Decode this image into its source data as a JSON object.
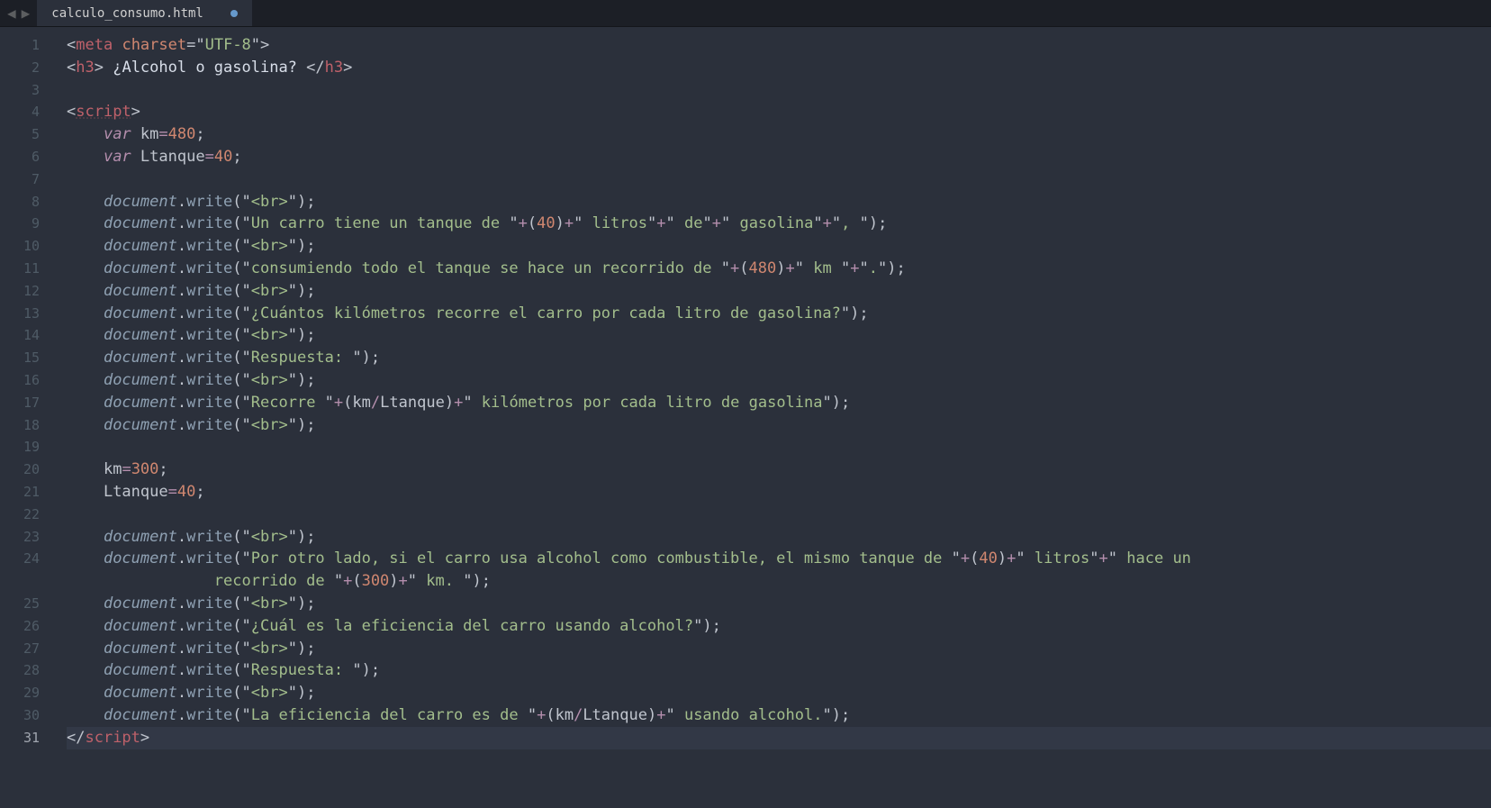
{
  "tab": {
    "filename": "calculo_consumo.html",
    "modified": true
  },
  "lineCount": 31,
  "activeLine": 31,
  "code": {
    "l1": [
      [
        "<",
        "c-punc"
      ],
      [
        "meta",
        "c-tag"
      ],
      [
        " ",
        "c-punc"
      ],
      [
        "charset",
        "c-attr"
      ],
      [
        "=",
        "c-op"
      ],
      [
        "\"",
        "c-punc"
      ],
      [
        "UTF-8",
        "c-string"
      ],
      [
        "\"",
        "c-punc"
      ],
      [
        ">",
        "c-punc"
      ]
    ],
    "l2": [
      [
        "<",
        "c-punc"
      ],
      [
        "h3",
        "c-tag"
      ],
      [
        ">",
        "c-punc"
      ],
      [
        " ¿Alcohol o gasolina? ",
        "c-text"
      ],
      [
        "</",
        "c-punc"
      ],
      [
        "h3",
        "c-tag"
      ],
      [
        ">",
        "c-punc"
      ]
    ],
    "l3": [],
    "l4": [
      [
        "<",
        "c-punc"
      ],
      [
        "script",
        "c-tag-dotted"
      ],
      [
        ">",
        "c-punc"
      ]
    ],
    "l5": [
      [
        "var",
        "c-store"
      ],
      [
        " ",
        "c-punc"
      ],
      [
        "km",
        "c-varname"
      ],
      [
        "=",
        "c-key"
      ],
      [
        "480",
        "c-num"
      ],
      [
        ";",
        "c-punc"
      ]
    ],
    "l6": [
      [
        "var",
        "c-store"
      ],
      [
        " ",
        "c-punc"
      ],
      [
        "Ltanque",
        "c-varname"
      ],
      [
        "=",
        "c-key"
      ],
      [
        "40",
        "c-num"
      ],
      [
        ";",
        "c-punc"
      ]
    ],
    "l7": [],
    "l8": [
      [
        "document",
        "c-obj"
      ],
      [
        ".",
        "c-punc"
      ],
      [
        "write",
        "c-func"
      ],
      [
        "(",
        "c-punc"
      ],
      [
        "\"",
        "c-punc"
      ],
      [
        "<br>",
        "c-string"
      ],
      [
        "\"",
        "c-punc"
      ],
      [
        ")",
        "c-punc"
      ],
      [
        ";",
        "c-punc"
      ]
    ],
    "l9": [
      [
        "document",
        "c-obj"
      ],
      [
        ".",
        "c-punc"
      ],
      [
        "write",
        "c-func"
      ],
      [
        "(",
        "c-punc"
      ],
      [
        "\"",
        "c-punc"
      ],
      [
        "Un carro tiene un tanque de ",
        "c-string"
      ],
      [
        "\"",
        "c-punc"
      ],
      [
        "+",
        "c-key"
      ],
      [
        "(",
        "c-punc"
      ],
      [
        "40",
        "c-num"
      ],
      [
        ")",
        "c-punc"
      ],
      [
        "+",
        "c-key"
      ],
      [
        "\"",
        "c-punc"
      ],
      [
        " litros",
        "c-string"
      ],
      [
        "\"",
        "c-punc"
      ],
      [
        "+",
        "c-key"
      ],
      [
        "\"",
        "c-punc"
      ],
      [
        " de",
        "c-string"
      ],
      [
        "\"",
        "c-punc"
      ],
      [
        "+",
        "c-key"
      ],
      [
        "\"",
        "c-punc"
      ],
      [
        " gasolina",
        "c-string"
      ],
      [
        "\"",
        "c-punc"
      ],
      [
        "+",
        "c-key"
      ],
      [
        "\"",
        "c-punc"
      ],
      [
        ", ",
        "c-string"
      ],
      [
        "\"",
        "c-punc"
      ],
      [
        ")",
        "c-punc"
      ],
      [
        ";",
        "c-punc"
      ]
    ],
    "l10": [
      [
        "document",
        "c-obj"
      ],
      [
        ".",
        "c-punc"
      ],
      [
        "write",
        "c-func"
      ],
      [
        "(",
        "c-punc"
      ],
      [
        "\"",
        "c-punc"
      ],
      [
        "<br>",
        "c-string"
      ],
      [
        "\"",
        "c-punc"
      ],
      [
        ")",
        "c-punc"
      ],
      [
        ";",
        "c-punc"
      ]
    ],
    "l11": [
      [
        "document",
        "c-obj"
      ],
      [
        ".",
        "c-punc"
      ],
      [
        "write",
        "c-func"
      ],
      [
        "(",
        "c-punc"
      ],
      [
        "\"",
        "c-punc"
      ],
      [
        "consumiendo todo el tanque se hace un recorrido de ",
        "c-string"
      ],
      [
        "\"",
        "c-punc"
      ],
      [
        "+",
        "c-key"
      ],
      [
        "(",
        "c-punc"
      ],
      [
        "480",
        "c-num"
      ],
      [
        ")",
        "c-punc"
      ],
      [
        "+",
        "c-key"
      ],
      [
        "\"",
        "c-punc"
      ],
      [
        " km ",
        "c-string"
      ],
      [
        "\"",
        "c-punc"
      ],
      [
        "+",
        "c-key"
      ],
      [
        "\"",
        "c-punc"
      ],
      [
        ".",
        "c-string"
      ],
      [
        "\"",
        "c-punc"
      ],
      [
        ")",
        "c-punc"
      ],
      [
        ";",
        "c-punc"
      ]
    ],
    "l12": [
      [
        "document",
        "c-obj"
      ],
      [
        ".",
        "c-punc"
      ],
      [
        "write",
        "c-func"
      ],
      [
        "(",
        "c-punc"
      ],
      [
        "\"",
        "c-punc"
      ],
      [
        "<br>",
        "c-string"
      ],
      [
        "\"",
        "c-punc"
      ],
      [
        ")",
        "c-punc"
      ],
      [
        ";",
        "c-punc"
      ]
    ],
    "l13": [
      [
        "document",
        "c-obj"
      ],
      [
        ".",
        "c-punc"
      ],
      [
        "write",
        "c-func"
      ],
      [
        "(",
        "c-punc"
      ],
      [
        "\"",
        "c-punc"
      ],
      [
        "¿Cuántos kilómetros recorre el carro por cada litro de gasolina?",
        "c-string"
      ],
      [
        "\"",
        "c-punc"
      ],
      [
        ")",
        "c-punc"
      ],
      [
        ";",
        "c-punc"
      ]
    ],
    "l14": [
      [
        "document",
        "c-obj"
      ],
      [
        ".",
        "c-punc"
      ],
      [
        "write",
        "c-func"
      ],
      [
        "(",
        "c-punc"
      ],
      [
        "\"",
        "c-punc"
      ],
      [
        "<br>",
        "c-string"
      ],
      [
        "\"",
        "c-punc"
      ],
      [
        ")",
        "c-punc"
      ],
      [
        ";",
        "c-punc"
      ]
    ],
    "l15": [
      [
        "document",
        "c-obj"
      ],
      [
        ".",
        "c-punc"
      ],
      [
        "write",
        "c-func"
      ],
      [
        "(",
        "c-punc"
      ],
      [
        "\"",
        "c-punc"
      ],
      [
        "Respuesta: ",
        "c-string"
      ],
      [
        "\"",
        "c-punc"
      ],
      [
        ")",
        "c-punc"
      ],
      [
        ";",
        "c-punc"
      ]
    ],
    "l16": [
      [
        "document",
        "c-obj"
      ],
      [
        ".",
        "c-punc"
      ],
      [
        "write",
        "c-func"
      ],
      [
        "(",
        "c-punc"
      ],
      [
        "\"",
        "c-punc"
      ],
      [
        "<br>",
        "c-string"
      ],
      [
        "\"",
        "c-punc"
      ],
      [
        ")",
        "c-punc"
      ],
      [
        ";",
        "c-punc"
      ]
    ],
    "l17": [
      [
        "document",
        "c-obj"
      ],
      [
        ".",
        "c-punc"
      ],
      [
        "write",
        "c-func"
      ],
      [
        "(",
        "c-punc"
      ],
      [
        "\"",
        "c-punc"
      ],
      [
        "Recorre ",
        "c-string"
      ],
      [
        "\"",
        "c-punc"
      ],
      [
        "+",
        "c-key"
      ],
      [
        "(",
        "c-punc"
      ],
      [
        "km",
        "c-varname"
      ],
      [
        "/",
        "c-key"
      ],
      [
        "Ltanque",
        "c-varname"
      ],
      [
        ")",
        "c-punc"
      ],
      [
        "+",
        "c-key"
      ],
      [
        "\"",
        "c-punc"
      ],
      [
        " kilómetros por cada litro de gasolina",
        "c-string"
      ],
      [
        "\"",
        "c-punc"
      ],
      [
        ")",
        "c-punc"
      ],
      [
        ";",
        "c-punc"
      ]
    ],
    "l18": [
      [
        "document",
        "c-obj"
      ],
      [
        ".",
        "c-punc"
      ],
      [
        "write",
        "c-func"
      ],
      [
        "(",
        "c-punc"
      ],
      [
        "\"",
        "c-punc"
      ],
      [
        "<br>",
        "c-string"
      ],
      [
        "\"",
        "c-punc"
      ],
      [
        ")",
        "c-punc"
      ],
      [
        ";",
        "c-punc"
      ]
    ],
    "l19": [],
    "l20": [
      [
        "km",
        "c-varname"
      ],
      [
        "=",
        "c-key"
      ],
      [
        "300",
        "c-num"
      ],
      [
        ";",
        "c-punc"
      ]
    ],
    "l21": [
      [
        "Ltanque",
        "c-varname"
      ],
      [
        "=",
        "c-key"
      ],
      [
        "40",
        "c-num"
      ],
      [
        ";",
        "c-punc"
      ]
    ],
    "l22": [],
    "l23": [
      [
        "document",
        "c-obj"
      ],
      [
        ".",
        "c-punc"
      ],
      [
        "write",
        "c-func"
      ],
      [
        "(",
        "c-punc"
      ],
      [
        "\"",
        "c-punc"
      ],
      [
        "<br>",
        "c-string"
      ],
      [
        "\"",
        "c-punc"
      ],
      [
        ")",
        "c-punc"
      ],
      [
        ";",
        "c-punc"
      ]
    ],
    "l24": [
      [
        "document",
        "c-obj"
      ],
      [
        ".",
        "c-punc"
      ],
      [
        "write",
        "c-func"
      ],
      [
        "(",
        "c-punc"
      ],
      [
        "\"",
        "c-punc"
      ],
      [
        "Por otro lado, si el carro usa alcohol como combustible, el mismo tanque de ",
        "c-string"
      ],
      [
        "\"",
        "c-punc"
      ],
      [
        "+",
        "c-key"
      ],
      [
        "(",
        "c-punc"
      ],
      [
        "40",
        "c-num"
      ],
      [
        ")",
        "c-punc"
      ],
      [
        "+",
        "c-key"
      ],
      [
        "\"",
        "c-punc"
      ],
      [
        " litros",
        "c-string"
      ],
      [
        "\"",
        "c-punc"
      ],
      [
        "+",
        "c-key"
      ],
      [
        "\"",
        "c-punc"
      ],
      [
        " hace un",
        "c-string"
      ]
    ],
    "l24b": [
      [
        "        recorrido de ",
        "c-string"
      ],
      [
        "\"",
        "c-punc"
      ],
      [
        "+",
        "c-key"
      ],
      [
        "(",
        "c-punc"
      ],
      [
        "300",
        "c-num"
      ],
      [
        ")",
        "c-punc"
      ],
      [
        "+",
        "c-key"
      ],
      [
        "\"",
        "c-punc"
      ],
      [
        " km. ",
        "c-string"
      ],
      [
        "\"",
        "c-punc"
      ],
      [
        ")",
        "c-punc"
      ],
      [
        ";",
        "c-punc"
      ]
    ],
    "l25": [
      [
        "document",
        "c-obj"
      ],
      [
        ".",
        "c-punc"
      ],
      [
        "write",
        "c-func"
      ],
      [
        "(",
        "c-punc"
      ],
      [
        "\"",
        "c-punc"
      ],
      [
        "<br>",
        "c-string"
      ],
      [
        "\"",
        "c-punc"
      ],
      [
        ")",
        "c-punc"
      ],
      [
        ";",
        "c-punc"
      ]
    ],
    "l26": [
      [
        "document",
        "c-obj"
      ],
      [
        ".",
        "c-punc"
      ],
      [
        "write",
        "c-func"
      ],
      [
        "(",
        "c-punc"
      ],
      [
        "\"",
        "c-punc"
      ],
      [
        "¿Cuál es la eficiencia del carro usando alcohol?",
        "c-string"
      ],
      [
        "\"",
        "c-punc"
      ],
      [
        ")",
        "c-punc"
      ],
      [
        ";",
        "c-punc"
      ]
    ],
    "l27": [
      [
        "document",
        "c-obj"
      ],
      [
        ".",
        "c-punc"
      ],
      [
        "write",
        "c-func"
      ],
      [
        "(",
        "c-punc"
      ],
      [
        "\"",
        "c-punc"
      ],
      [
        "<br>",
        "c-string"
      ],
      [
        "\"",
        "c-punc"
      ],
      [
        ")",
        "c-punc"
      ],
      [
        ";",
        "c-punc"
      ]
    ],
    "l28": [
      [
        "document",
        "c-obj"
      ],
      [
        ".",
        "c-punc"
      ],
      [
        "write",
        "c-func"
      ],
      [
        "(",
        "c-punc"
      ],
      [
        "\"",
        "c-punc"
      ],
      [
        "Respuesta: ",
        "c-string"
      ],
      [
        "\"",
        "c-punc"
      ],
      [
        ")",
        "c-punc"
      ],
      [
        ";",
        "c-punc"
      ]
    ],
    "l29": [
      [
        "document",
        "c-obj"
      ],
      [
        ".",
        "c-punc"
      ],
      [
        "write",
        "c-func"
      ],
      [
        "(",
        "c-punc"
      ],
      [
        "\"",
        "c-punc"
      ],
      [
        "<br>",
        "c-string"
      ],
      [
        "\"",
        "c-punc"
      ],
      [
        ")",
        "c-punc"
      ],
      [
        ";",
        "c-punc"
      ]
    ],
    "l30": [
      [
        "document",
        "c-obj"
      ],
      [
        ".",
        "c-punc"
      ],
      [
        "write",
        "c-func"
      ],
      [
        "(",
        "c-punc"
      ],
      [
        "\"",
        "c-punc"
      ],
      [
        "La eficiencia del carro es de ",
        "c-string"
      ],
      [
        "\"",
        "c-punc"
      ],
      [
        "+",
        "c-key"
      ],
      [
        "(",
        "c-punc"
      ],
      [
        "km",
        "c-varname"
      ],
      [
        "/",
        "c-key"
      ],
      [
        "Ltanque",
        "c-varname"
      ],
      [
        ")",
        "c-punc"
      ],
      [
        "+",
        "c-key"
      ],
      [
        "\"",
        "c-punc"
      ],
      [
        " usando alcohol.",
        "c-string"
      ],
      [
        "\"",
        "c-punc"
      ],
      [
        ")",
        "c-punc"
      ],
      [
        ";",
        "c-punc"
      ]
    ],
    "l31": [
      [
        "</",
        "c-punc"
      ],
      [
        "script",
        "c-tag"
      ],
      [
        ">",
        "c-punc"
      ]
    ]
  },
  "indentation": {
    "noIndent": [
      1,
      2,
      3,
      4,
      31
    ],
    "singleIndent": [],
    "doubleIndent": [
      5,
      6,
      7,
      8,
      9,
      10,
      11,
      12,
      13,
      14,
      15,
      16,
      17,
      18,
      19,
      20,
      21,
      22,
      23,
      24,
      25,
      26,
      27,
      28,
      29,
      30
    ],
    "wrapLine": [
      "24b"
    ]
  }
}
